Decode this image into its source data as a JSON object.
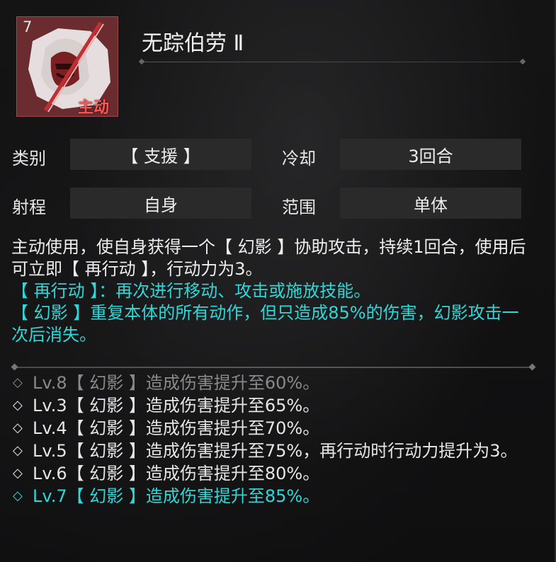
{
  "skill": {
    "level": "7",
    "type_label": "主动",
    "name": "无踪伯劳 Ⅱ",
    "icon": "hooded-assassin-icon"
  },
  "stats": {
    "category_label": "类别",
    "category_value": "【 支援 】",
    "cooldown_label": "冷却",
    "cooldown_value": "3回合",
    "range_label": "射程",
    "range_value": "自身",
    "area_label": "范围",
    "area_value": "单体"
  },
  "description": {
    "line1": "主动使用，使自身获得一个【 幻影 】协助攻击，持续1回合，使用后可立即【 再行动 】，行动力为3。",
    "line2": "【 再行动 】：再次进行移动、攻击或施放技能。",
    "line3": "【 幻影 】重复本体的所有动作，但只造成85%的伤害，幻影攻击一次后消失。"
  },
  "levels": [
    {
      "bullet": "◇",
      "text": "Lv.8【 幻影 】造成伤害提升至60%。",
      "state": "dim"
    },
    {
      "bullet": "◇",
      "text": "Lv.3【 幻影 】造成伤害提升至65%。",
      "state": "normal"
    },
    {
      "bullet": "◇",
      "text": "Lv.4【 幻影 】造成伤害提升至70%。",
      "state": "normal"
    },
    {
      "bullet": "◇",
      "text": "Lv.5【 幻影 】造成伤害提升至75%，再行动时行动力提升为3。",
      "state": "normal"
    },
    {
      "bullet": "◇",
      "text": "Lv.6【 幻影 】造成伤害提升至80%。",
      "state": "normal"
    },
    {
      "bullet": "◇",
      "text": "Lv.7【 幻影 】造成伤害提升至85%。",
      "state": "active"
    }
  ],
  "colors": {
    "accent_cyan": "#2fd8d8",
    "type_red": "#ff5555",
    "icon_bg": "#6a2c2f"
  }
}
